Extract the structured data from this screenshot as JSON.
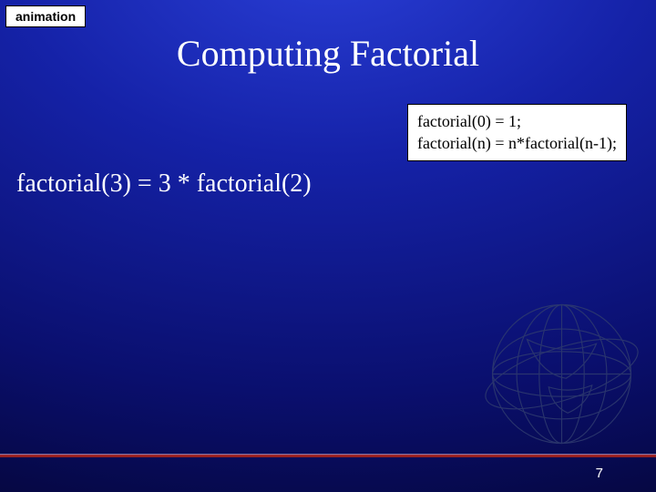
{
  "tag": {
    "label": "animation"
  },
  "title": "Computing Factorial",
  "rules": {
    "line1": "factorial(0) = 1;",
    "line2": "factorial(n) = n*factorial(n-1);"
  },
  "step": "factorial(3) = 3 * factorial(2)",
  "slide_number": "7"
}
